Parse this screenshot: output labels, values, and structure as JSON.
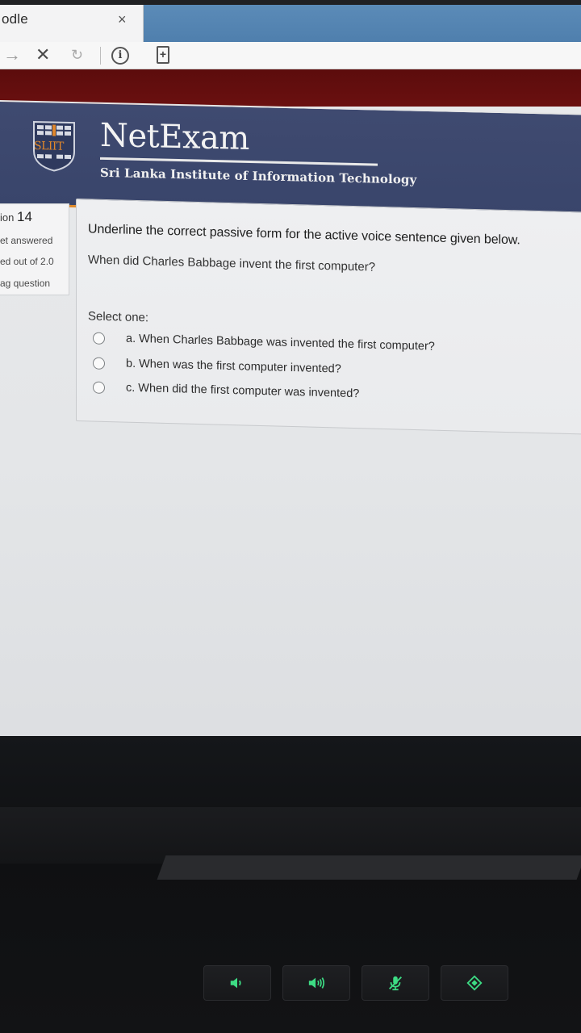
{
  "browser": {
    "tab_title": "odle",
    "tab_close": "×",
    "nav": {
      "forward_icon": "→",
      "stop_icon": "✕",
      "reload_icon": "↻",
      "info_icon": "i",
      "page_icon": "+"
    }
  },
  "header": {
    "logo_text": "SLIIT",
    "title": "NetExam",
    "subtitle": "Sri Lanka Institute of Information Technology"
  },
  "question_info": {
    "label": "ion",
    "number": "14",
    "status": "et answered",
    "marks": "ed out of 2.0",
    "flag": "ag question"
  },
  "question": {
    "prompt": "Underline the correct passive form for the active voice sentence given below.",
    "sentence": "When did Charles Babbage invent the first computer?",
    "select_label": "Select one:",
    "options": [
      "a. When Charles Babbage was invented the first computer?",
      "b. When was the first computer invented?",
      "c. When did the first computer was invented?"
    ]
  },
  "colors": {
    "header_bg": "#3f4a70",
    "maroon_bar": "#6a1010",
    "tab_strip": "#5b8bb8",
    "accent_orange": "#e08a2a",
    "fn_key_green": "#3ddc84"
  }
}
